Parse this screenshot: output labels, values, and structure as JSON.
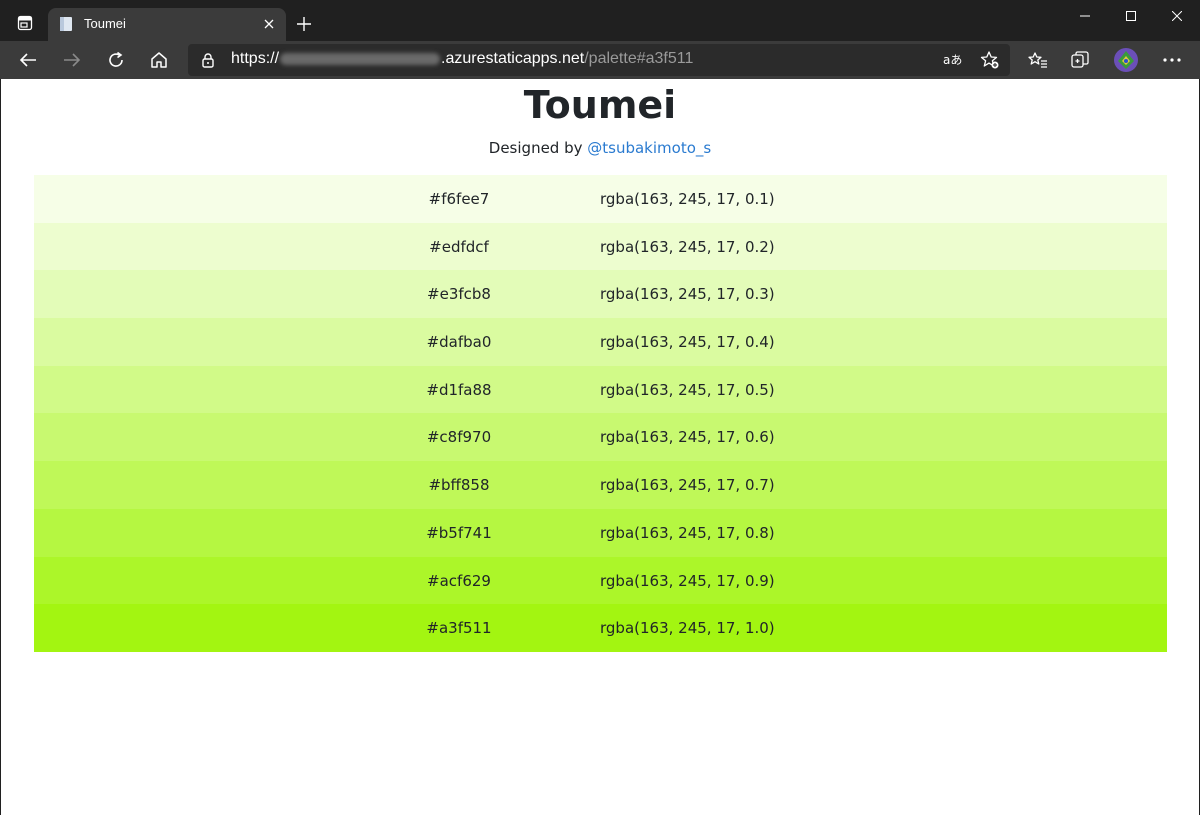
{
  "browser": {
    "tab": {
      "title": "Toumei"
    },
    "address": {
      "scheme": "https://",
      "domain": ".azurestaticapps.net",
      "path": "/palette#a3f511"
    }
  },
  "page": {
    "title": "Toumei",
    "byline_prefix": "Designed by ",
    "byline_link": "@tsubakimoto_s",
    "palette": [
      {
        "hex": "#f6fee7",
        "rgba": "rgba(163, 245, 17, 0.1)",
        "color": "#f6fee7"
      },
      {
        "hex": "#edfdcf",
        "rgba": "rgba(163, 245, 17, 0.2)",
        "color": "#edfdcf"
      },
      {
        "hex": "#e3fcb8",
        "rgba": "rgba(163, 245, 17, 0.3)",
        "color": "#e3fcb8"
      },
      {
        "hex": "#dafba0",
        "rgba": "rgba(163, 245, 17, 0.4)",
        "color": "#dafba0"
      },
      {
        "hex": "#d1fa88",
        "rgba": "rgba(163, 245, 17, 0.5)",
        "color": "#d1fa88"
      },
      {
        "hex": "#c8f970",
        "rgba": "rgba(163, 245, 17, 0.6)",
        "color": "#c8f970"
      },
      {
        "hex": "#bff858",
        "rgba": "rgba(163, 245, 17, 0.7)",
        "color": "#bff858"
      },
      {
        "hex": "#b5f741",
        "rgba": "rgba(163, 245, 17, 0.8)",
        "color": "#b5f741"
      },
      {
        "hex": "#acf629",
        "rgba": "rgba(163, 245, 17, 0.9)",
        "color": "#acf629"
      },
      {
        "hex": "#a3f511",
        "rgba": "rgba(163, 245, 17, 1.0)",
        "color": "#a3f511"
      }
    ]
  },
  "icons": {
    "tab_actions": "tab-actions-icon",
    "favicon": "page-icon",
    "back": "back-arrow-icon",
    "forward": "forward-arrow-icon",
    "refresh": "refresh-icon",
    "home": "home-icon",
    "lock": "lock-icon",
    "read_aloud": "read-aloud-icon",
    "add_favorite": "add-favorite-icon",
    "favorites": "favorites-icon",
    "collections": "collections-icon",
    "profile": "profile-avatar",
    "menu": "more-menu-icon"
  }
}
